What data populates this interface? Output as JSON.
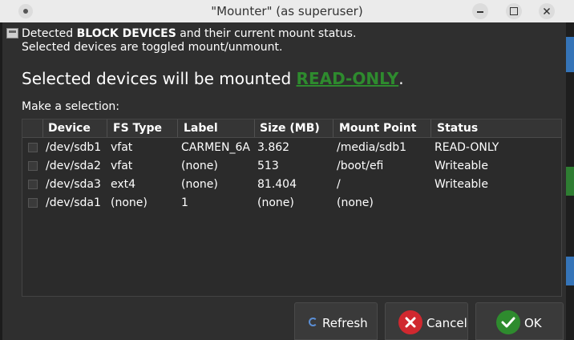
{
  "window": {
    "title": "\"Mounter\" (as superuser)"
  },
  "info": {
    "line1_pre": "Detected ",
    "line1_bold": "BLOCK DEVICES",
    "line1_post": " and their current mount status.",
    "line2": "Selected devices are toggled mount/unmount."
  },
  "heading": {
    "prefix": "Selected devices will be mounted ",
    "mode": "READ-ONLY",
    "suffix": "."
  },
  "selection_label": "Make a selection:",
  "table": {
    "columns": [
      "Device",
      "FS Type",
      "Label",
      "Size (MB)",
      "Mount Point",
      "Status"
    ],
    "rows": [
      {
        "device": "/dev/sdb1",
        "fs_type": "vfat",
        "label": "CARMEN_6A",
        "size": "3.862",
        "mount_point": "/media/sdb1",
        "status": "READ-ONLY",
        "checked": false
      },
      {
        "device": "/dev/sda2",
        "fs_type": "vfat",
        "label": "(none)",
        "size": "513",
        "mount_point": "/boot/efi",
        "status": "Writeable",
        "checked": false
      },
      {
        "device": "/dev/sda3",
        "fs_type": "ext4",
        "label": "(none)",
        "size": "81.404",
        "mount_point": "/",
        "status": "Writeable",
        "checked": false
      },
      {
        "device": "/dev/sda1",
        "fs_type": "(none)",
        "label": "1",
        "size": "(none)",
        "mount_point": "(none)",
        "status": "",
        "checked": false
      }
    ]
  },
  "buttons": {
    "refresh": "Refresh",
    "cancel": "Cancel",
    "ok": "OK"
  },
  "icons": {
    "window_menu": "circle-dot-icon",
    "minimize": "minimize-icon",
    "maximize": "maximize-icon",
    "close": "close-icon",
    "info": "drive-icon",
    "refresh": "refresh-icon",
    "cancel": "x-circle-icon",
    "ok": "check-circle-icon"
  },
  "colors": {
    "read_only": "#2e8b2e",
    "cancel_icon": "#d0282f",
    "ok_icon": "#2e8b2e",
    "refresh_icon": "#5b8fd6"
  }
}
